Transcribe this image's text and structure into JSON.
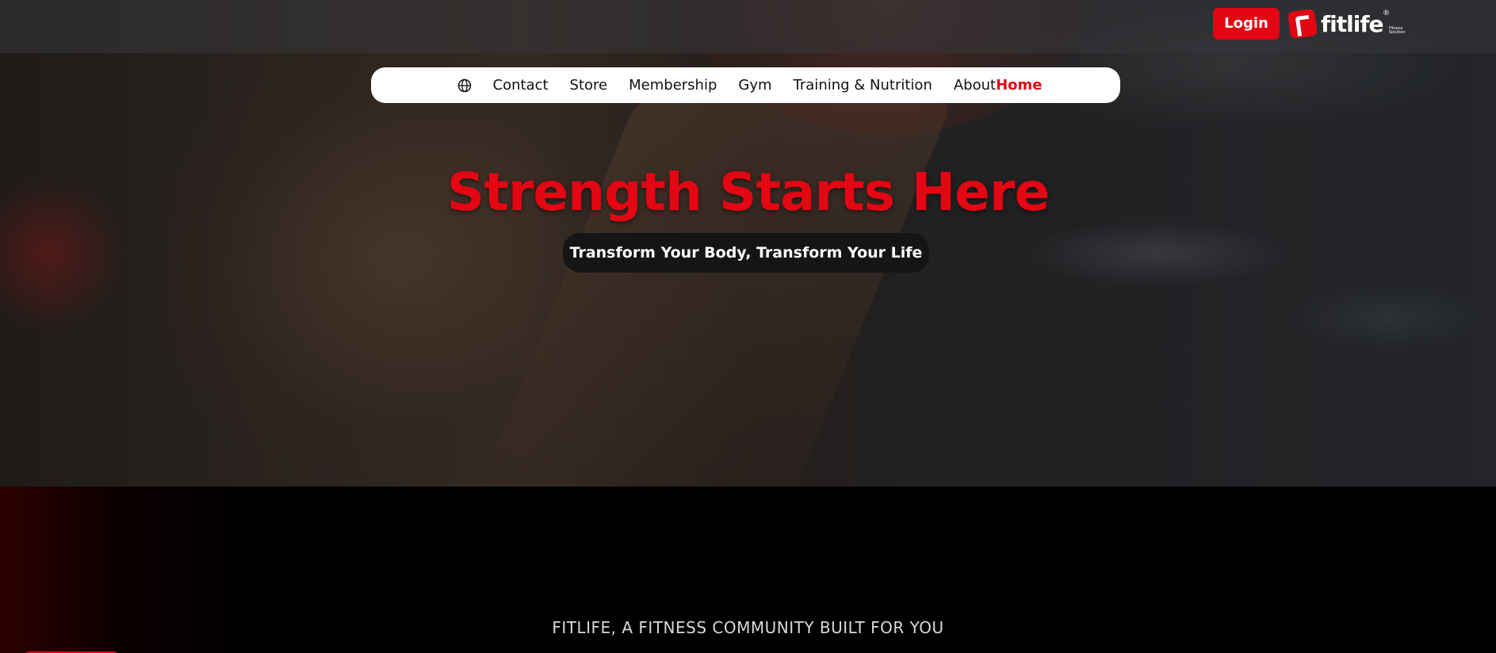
{
  "header": {
    "login_label": "Login",
    "logo": {
      "name": "fitlife",
      "registered_mark": "®",
      "sub": "Fitness Solution"
    }
  },
  "nav": {
    "language_icon": "globe-icon",
    "items": [
      {
        "label": "Contact",
        "active": false
      },
      {
        "label": "Store",
        "active": false
      },
      {
        "label": "Membership",
        "active": false
      },
      {
        "label": "Gym",
        "active": false
      },
      {
        "label": "Training & Nutrition",
        "active": false
      },
      {
        "label": "About",
        "active": false
      },
      {
        "label": "Home",
        "active": true
      }
    ]
  },
  "hero": {
    "title": "Strength Starts Here",
    "subtitle": "Transform Your Body, Transform Your Life"
  },
  "section": {
    "tagline": "FITLIFE, A FITNESS COMMUNITY BUILT FOR YOU"
  },
  "colors": {
    "accent": "#e30613",
    "nav_bg": "#ffffff",
    "subtitle_bg": "#151515",
    "page_bg": "#000000"
  }
}
